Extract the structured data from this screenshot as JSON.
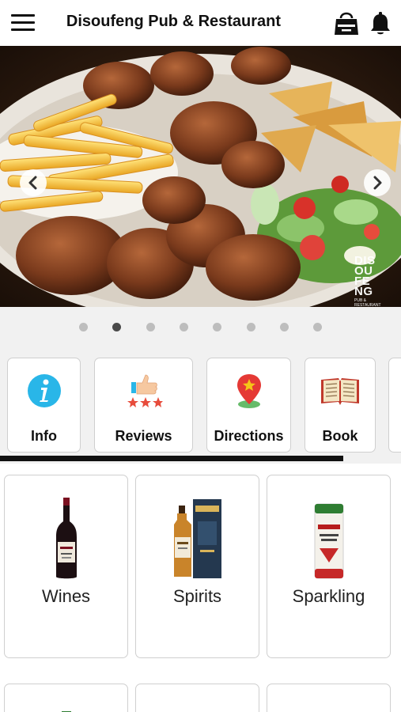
{
  "header": {
    "title": "Disoufeng Pub & Restaurant",
    "menu_icon": "hamburger-menu-icon",
    "cart_icon": "shopping-bag-icon",
    "notification_icon": "bell-icon"
  },
  "slider": {
    "image_alt": "Grilled meat platter with fries, salad and samosas",
    "watermark": [
      "DIS",
      "OU",
      "FE",
      "NG"
    ],
    "watermark_sub": "PUB & RESTAURANT",
    "prev_icon": "chevron-left-icon",
    "next_icon": "chevron-right-icon",
    "total_slides": 8,
    "active_slide": 2
  },
  "actions": [
    {
      "label": "Info",
      "icon": "info-icon"
    },
    {
      "label": "Reviews",
      "icon": "thumbs-up-stars-icon"
    },
    {
      "label": "Directions",
      "icon": "map-pin-icon"
    },
    {
      "label": "Book",
      "icon": "open-book-icon"
    }
  ],
  "categories": [
    {
      "label": "Wines",
      "icon": "wine-bottle-icon"
    },
    {
      "label": "Spirits",
      "icon": "whisky-bottle-icon"
    },
    {
      "label": "Sparkling",
      "icon": "sparkling-can-icon"
    }
  ],
  "colors": {
    "accent_cyan": "#29b6e8",
    "pin_red": "#e53935",
    "pin_yellow": "#f5c518",
    "pin_green": "#66bb6a",
    "page_grey": "#f1f1f1",
    "border": "#cfcfcf"
  }
}
